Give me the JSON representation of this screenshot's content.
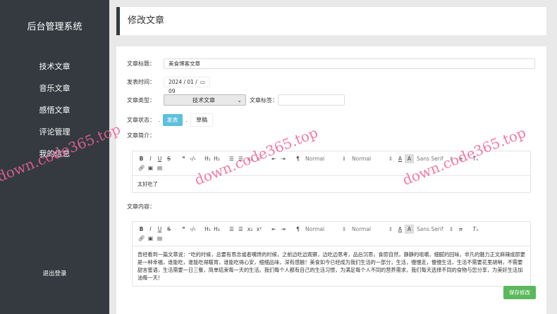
{
  "sidebar": {
    "brand": "后台管理系统",
    "items": [
      "技术文章",
      "音乐文章",
      "感悟文章",
      "评论管理",
      "我的信息"
    ],
    "logout": "退出登录"
  },
  "header": {
    "title": "修改文章"
  },
  "form": {
    "title_label": "文章标题：",
    "title_value": "美食博客文章",
    "date_label": "发表时间：",
    "date_value": "2024 / 01 / 09",
    "type_label": "文章类型：",
    "type_value": "技术文章",
    "tag_label": "文章标签：",
    "tag_value": "",
    "status_label": "文章状态：",
    "status_publish": "发表",
    "status_draft": "草稿",
    "summary_label": "文章简介：",
    "summary_value": "太好吃了",
    "content_label": "文章内容：",
    "content_value": "曾经看到一篇文章说：“吃的时候，总要有思念或者嘴馋的时候，之前边吃边观察，边吃边思考，品后沉思，食即自然，静静的咀嚼，细腻的回味，非凡的魅力正文麻辣成即更是一种幸福，谁能吃，谁能吃得暖胃，谁能吃得心安，细细品味，深有感触！美食如今已经成为我们生活的一部分，生活，慢慢走，慢慢生活，生活不需要花里胡哨，不需要甜言蜜语，生活需要一日三餐，简单结束每一天的生活。我们每个人都有自己的生活习惯，为满足每个人不同的营养需求，我们每天选择不同的食物与您分享，为美好生活加油每一天！",
    "save": "保存修改"
  },
  "toolbar": {
    "header": "Normal",
    "size": "Normal",
    "font": "Sans Serif"
  },
  "watermark": "down.code365.top"
}
